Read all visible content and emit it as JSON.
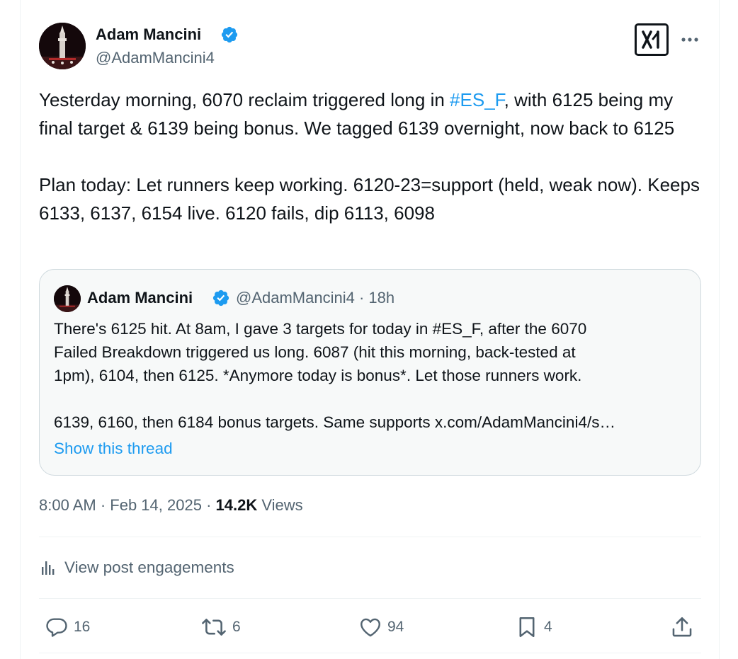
{
  "author": {
    "name": "Adam Mancini",
    "handle": "@AdamMancini4",
    "verified_color": "#1d9bf0"
  },
  "post": {
    "paragraph1_before": "Yesterday morning, 6070 reclaim triggered long in ",
    "paragraph1_hashtag": "#ES_F",
    "paragraph1_after": ", with 6125 being my final target & 6139 being bonus. We tagged 6139 overnight, now back to 6125",
    "paragraph2": "Plan today: Let runners keep working. 6120-23=support (held, weak now). Keeps 6133, 6137, 6154 live. 6120 fails, dip 6113, 6098"
  },
  "quote": {
    "author_name": "Adam Mancini",
    "author_handle": "@AdamMancini4",
    "separator": " · ",
    "age": "18h",
    "lines": [
      "There's 6125 hit. At 8am, I gave 3 targets for today in #ES_F, after the 6070",
      "Failed Breakdown triggered us long. 6087 (hit this morning, back-tested at",
      "1pm), 6104, then 6125. *Anymore today is bonus*. Let those runners work."
    ],
    "line4": "6139, 6160, then 6184 bonus targets. Same supports x.com/AdamMancini4/s…",
    "show_thread_label": "Show this thread"
  },
  "meta": {
    "time": "8:00 AM",
    "separator": " · ",
    "date": "Feb 14, 2025",
    "views_count": "14.2K",
    "views_label": " Views"
  },
  "engagements_label": "View post engagements",
  "actions": {
    "replies": "16",
    "reposts": "6",
    "likes": "94",
    "bookmarks": "4"
  },
  "icons": {
    "verified": "verified-badge-icon",
    "grok": "grok-icon",
    "more": "more-dots-icon",
    "engagements": "bar-chart-icon",
    "reply": "reply-bubble-icon",
    "repost": "repost-arrows-icon",
    "like": "heart-icon",
    "bookmark": "bookmark-icon",
    "share": "share-upload-icon"
  },
  "colors": {
    "text": "#0f1419",
    "secondary": "#536471",
    "link": "#1d9bf0",
    "border": "#cfd9de",
    "quote_bg": "#f7f9f9"
  }
}
